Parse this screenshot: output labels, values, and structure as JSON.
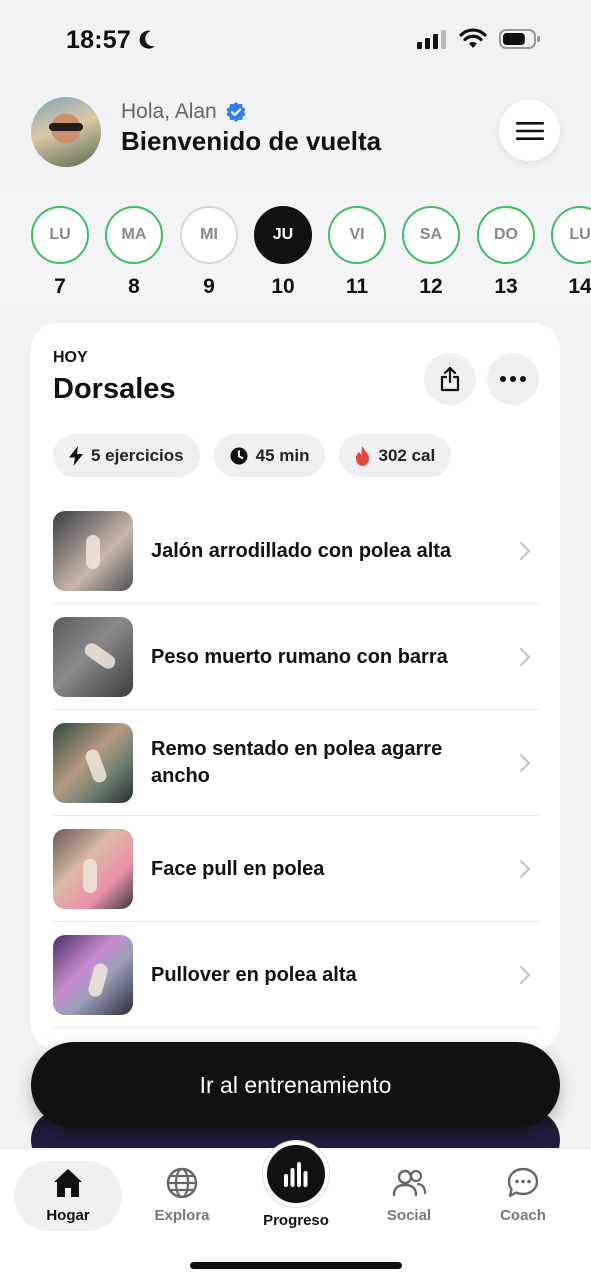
{
  "status_bar": {
    "time": "18:57",
    "battery_level": 0.75
  },
  "header": {
    "greeting": "Hola, Alan",
    "welcome": "Bienvenido de vuelta"
  },
  "days": [
    {
      "abbr": "LU",
      "num": "7",
      "state": "done"
    },
    {
      "abbr": "MA",
      "num": "8",
      "state": "done"
    },
    {
      "abbr": "MI",
      "num": "9",
      "state": "empty"
    },
    {
      "abbr": "JU",
      "num": "10",
      "state": "active"
    },
    {
      "abbr": "VI",
      "num": "11",
      "state": "done"
    },
    {
      "abbr": "SA",
      "num": "12",
      "state": "done"
    },
    {
      "abbr": "DO",
      "num": "13",
      "state": "done"
    },
    {
      "abbr": "LU",
      "num": "14",
      "state": "done"
    }
  ],
  "workout": {
    "eyebrow": "HOY",
    "title": "Dorsales",
    "chips": [
      {
        "icon": "bolt-icon",
        "label": "5 ejercicios"
      },
      {
        "icon": "clock-icon",
        "label": "45 min"
      },
      {
        "icon": "flame-icon",
        "label": "302 cal",
        "color": "#e8453c"
      }
    ],
    "exercises": [
      {
        "name": "Jalón arrodillado con polea alta"
      },
      {
        "name": "Peso muerto rumano con barra"
      },
      {
        "name": "Remo sentado en polea agarre ancho"
      },
      {
        "name": "Face pull en polea"
      },
      {
        "name": "Pullover en polea alta"
      }
    ]
  },
  "cta": {
    "label": "Ir al entrenamiento"
  },
  "tabs": {
    "home": "Hogar",
    "explore": "Explora",
    "progress": "Progreso",
    "social": "Social",
    "coach": "Coach"
  },
  "colors": {
    "accent_green": "#3dbf5c",
    "verified_blue": "#2f80ed",
    "flame": "#e8453c"
  }
}
